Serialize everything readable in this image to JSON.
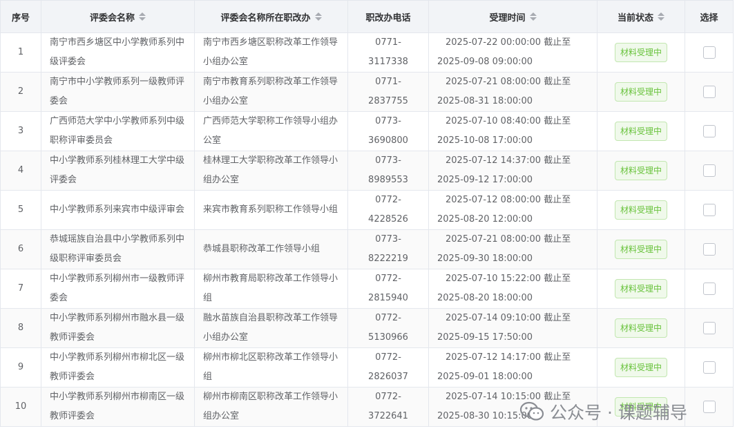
{
  "table": {
    "headers": {
      "index": "序号",
      "name": "评委会名称",
      "office": "评委会名称所在职改办",
      "phone": "职改办电话",
      "time": "受理时间",
      "status": "当前状态",
      "select": "选择"
    },
    "rows": [
      {
        "index": "1",
        "name": "南宁市西乡塘区中小学教师系列中级评委会",
        "office": "南宁市西乡塘区职称改革工作领导小组办公室",
        "phone": "0771-3117338",
        "time": "2025-07-22 00:00:00 截止至 2025-09-08 09:00:00",
        "status": "材料受理中"
      },
      {
        "index": "2",
        "name": "南宁市中小学教师系列一级教师评委会",
        "office": "南宁市教育系列职称改革工作领导小组办公室",
        "phone": "0771-2837755",
        "time": "2025-07-21 08:00:00 截止至 2025-08-31 18:00:00",
        "status": "材料受理中"
      },
      {
        "index": "3",
        "name": "广西师范大学中小学教师系列中级职称评审委员会",
        "office": "广西师范大学职称工作领导小组办公室",
        "phone": "0773-3690800",
        "time": "2025-07-10 08:40:00 截止至 2025-10-08 17:00:00",
        "status": "材料受理中"
      },
      {
        "index": "4",
        "name": "中小学教师系列桂林理工大学中级评委会",
        "office": "桂林理工大学职称改革工作领导小组办公室",
        "phone": "0773-8989553",
        "time": "2025-07-12 14:37:00 截止至 2025-09-12 17:00:00",
        "status": "材料受理中"
      },
      {
        "index": "5",
        "name": "中小学教师系列来宾市中级评审会",
        "office": "来宾市教育系列职称工作领导小组",
        "phone": "0772-4228526",
        "time": "2025-07-12 08:00:00 截止至 2025-08-20 12:00:00",
        "status": "材料受理中"
      },
      {
        "index": "6",
        "name": "恭城瑶族自治县中小学教师系列中级职称评审委员会",
        "office": "恭城县职称改革工作领导小组",
        "phone": "0773-8222219",
        "time": "2025-07-21 08:00:00 截止至 2025-09-30 18:00:00",
        "status": "材料受理中"
      },
      {
        "index": "7",
        "name": "中小学教师系列柳州市一级教师评委会",
        "office": "柳州市教育局职称改革工作领导小组",
        "phone": "0772-2815940",
        "time": "2025-07-10 15:22:00 截止至 2025-08-20 18:00:00",
        "status": "材料受理中"
      },
      {
        "index": "8",
        "name": "中小学教师系列柳州市融水县一级教师评委会",
        "office": "融水苗族自治县职称改革工作领导小组办公室",
        "phone": "0772-5130966",
        "time": "2025-07-14 09:10:00 截止至 2025-09-15 17:50:00",
        "status": "材料受理中"
      },
      {
        "index": "9",
        "name": "中小学教师系列柳州市柳北区一级教师评委会",
        "office": "柳州市柳北区职称改革工作领导小组",
        "phone": "0772-2826037",
        "time": "2025-07-12 14:17:00 截止至 2025-09-01 18:00:00",
        "status": "材料受理中"
      },
      {
        "index": "10",
        "name": "中小学教师系列柳州市柳南区一级教师评委会",
        "office": "柳州市柳南区职称改革工作领导小组办公室",
        "phone": "0772-3722641",
        "time": "2025-07-14 10:15:00 截止至 2025-08-30 10:15:00",
        "status": "材料受理中"
      }
    ]
  },
  "watermark": {
    "text": "公众号 · 课题辅导",
    "icon": "wechat-icon"
  },
  "colors": {
    "status_green": "#67c23a",
    "header_bg": "#f2f4f7"
  }
}
